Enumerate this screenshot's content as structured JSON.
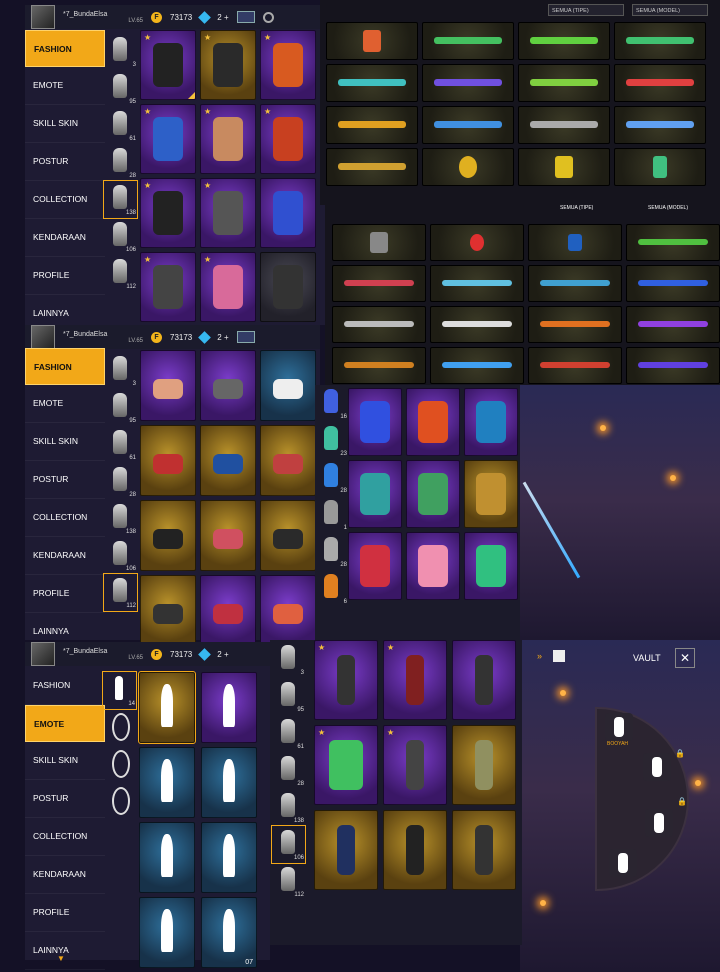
{
  "player": {
    "name": "*7_BundaElsa",
    "level": "LV.65"
  },
  "currency": {
    "gold": "73173",
    "diamonds": "2",
    "diamond_plus": "+"
  },
  "filters": {
    "type": "SEMUA (TIPE)",
    "model": "SEMUA (MODEL)"
  },
  "menu": [
    "FASHION",
    "EMOTE",
    "SKILL SKIN",
    "POSTUR",
    "COLLECTION",
    "KENDARAAN",
    "PROFILE",
    "LAINNYA"
  ],
  "sub_counts_a": [
    "3",
    "95",
    "61",
    "28",
    "138",
    "106",
    "112"
  ],
  "sub_counts_b": [
    "3",
    "95",
    "61",
    "28",
    "138",
    "106",
    "112"
  ],
  "sub_counts_c": [
    "14",
    "",
    "",
    ""
  ],
  "sub_counts_d": [
    "3",
    "95",
    "61",
    "28",
    "138",
    "106",
    "112"
  ],
  "collection_counts": [
    "16",
    "23",
    "28",
    "1",
    "28",
    "6"
  ],
  "vault": {
    "title": "VAULT",
    "selected_label": "BOOYAH"
  },
  "emote_last_count": "07",
  "colors": {
    "accent": "#f2a818",
    "panel_bg": "#1b1b2c"
  }
}
